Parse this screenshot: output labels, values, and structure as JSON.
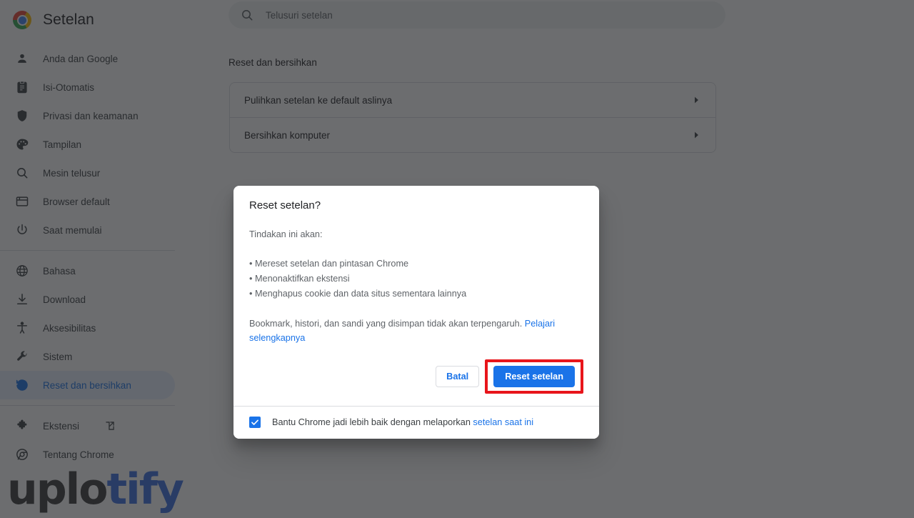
{
  "app": {
    "title": "Setelan",
    "logo_icon": "chrome-logo-icon"
  },
  "search": {
    "placeholder": "Telusuri setelan",
    "icon": "search-icon",
    "value": ""
  },
  "sidebar": {
    "items": [
      {
        "label": "Anda dan Google",
        "icon": "person-icon",
        "selected": false
      },
      {
        "label": "Isi-Otomatis",
        "icon": "clipboard-icon",
        "selected": false
      },
      {
        "label": "Privasi dan keamanan",
        "icon": "shield-icon",
        "selected": false
      },
      {
        "label": "Tampilan",
        "icon": "palette-icon",
        "selected": false
      },
      {
        "label": "Mesin telusur",
        "icon": "search-icon",
        "selected": false
      },
      {
        "label": "Browser default",
        "icon": "browser-window-icon",
        "selected": false
      },
      {
        "label": "Saat memulai",
        "icon": "power-icon",
        "selected": false
      },
      {
        "label": "Bahasa",
        "icon": "globe-icon",
        "selected": false
      },
      {
        "label": "Download",
        "icon": "download-icon",
        "selected": false
      },
      {
        "label": "Aksesibilitas",
        "icon": "accessibility-icon",
        "selected": false
      },
      {
        "label": "Sistem",
        "icon": "wrench-icon",
        "selected": false
      },
      {
        "label": "Reset dan bersihkan",
        "icon": "history-restore-icon",
        "selected": true
      },
      {
        "label": "Ekstensi",
        "icon": "puzzle-icon",
        "selected": false
      },
      {
        "label": "Tentang Chrome",
        "icon": "chrome-outline-icon",
        "selected": false
      }
    ],
    "extensions_external_icon": "external-link-icon"
  },
  "main": {
    "section_title": "Reset dan bersihkan",
    "rows": [
      {
        "label": "Pulihkan setelan ke default aslinya",
        "icon": "chevron-right-icon"
      },
      {
        "label": "Bersihkan komputer",
        "icon": "chevron-right-icon"
      }
    ]
  },
  "dialog": {
    "title": "Reset setelan?",
    "intro": "Tindakan ini akan:",
    "bullets": [
      "• Mereset setelan dan pintasan Chrome",
      "• Menonaktifkan ekstensi",
      "• Menghapus cookie dan data situs sementara lainnya"
    ],
    "note_text": "Bookmark, histori, dan sandi yang disimpan tidak akan terpengaruh. ",
    "note_link": "Pelajari selengkapnya",
    "cancel_label": "Batal",
    "confirm_label": "Reset setelan",
    "footer_text": "Bantu Chrome jadi lebih baik dengan melaporkan ",
    "footer_link": "setelan saat ini",
    "checkbox_checked": true,
    "checkbox_icon": "checkmark-icon",
    "highlight_color": "#e8151b"
  },
  "watermark": {
    "part_dark": "uplo",
    "part_blue": "tify"
  },
  "colors": {
    "accent": "#1a73e8",
    "selected_bg": "#e8f0fe",
    "scrim": "#202124",
    "highlight": "#e8151b"
  }
}
